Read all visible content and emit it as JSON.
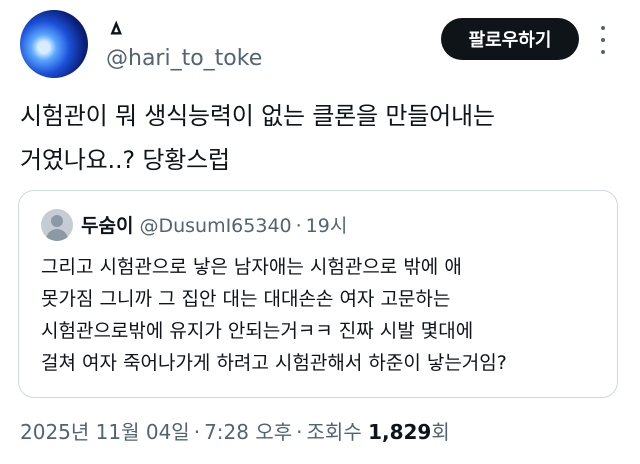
{
  "author": {
    "display_name": "ㅿ",
    "handle": "@hari_to_toke",
    "follow_label": "팔로우하기"
  },
  "tweet": {
    "lines": [
      "시험관이 뭐 생식능력이 없는 클론을 만들어내는",
      "거였나요..? 당황스럽"
    ]
  },
  "quote": {
    "display_name": "두숨이",
    "handle": "@DusumI65340",
    "dot": "·",
    "time": "19시",
    "lines": [
      "그리고 시험관으로 낳은 남자애는 시험관으로 밖에 애",
      "못가짐 그니까 그 집안 대는 대대손손 여자 고문하는",
      "시험관으로밖에 유지가 안되는거ㅋㅋ 진짜 시발 몇대에",
      "걸쳐 여자 죽어나가게 하려고 시험관해서 하준이 낳는거임?"
    ]
  },
  "meta": {
    "date": "2025년 11월 04일",
    "sep1": "·",
    "time": "7:28 오후",
    "sep2": "·",
    "views_label": "조회수",
    "views_count": "1,829",
    "views_suffix": "회"
  },
  "icons": {
    "more": "more-vertical-icon",
    "quote_avatar": "default-avatar-icon"
  }
}
